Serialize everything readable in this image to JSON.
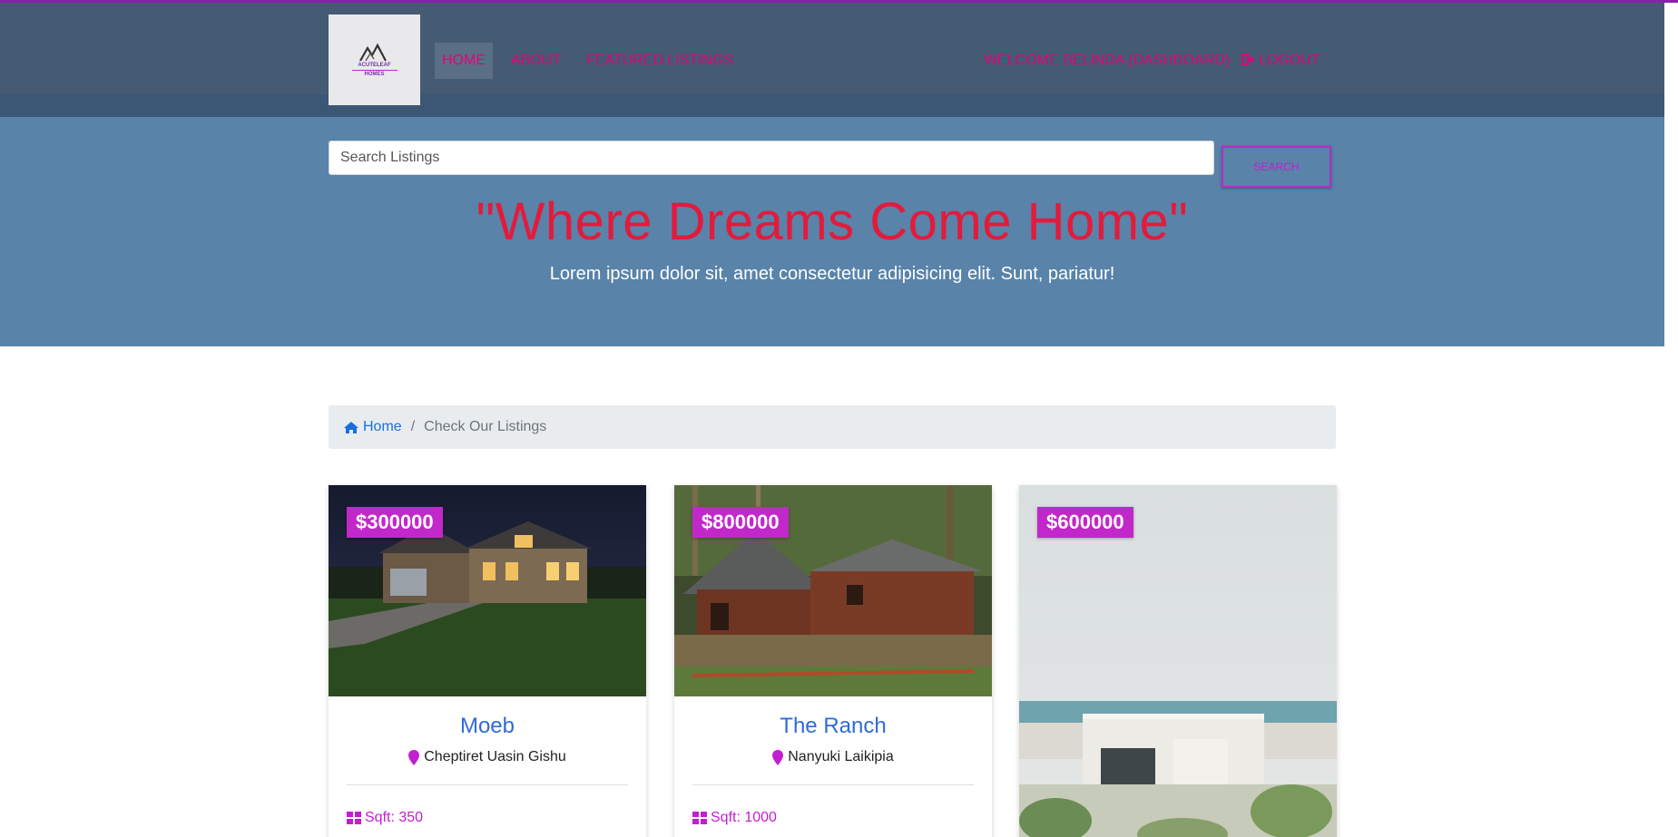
{
  "brand": {
    "logo_text_line1": "ACUTELEAF",
    "logo_text_line2": "HOMES"
  },
  "nav": {
    "home": "HOME",
    "about": "ABOUT",
    "featured": "FEATURED LISTINGS",
    "welcome": "WELCOME BELINDA (DASHBOARD)",
    "logout": "LOGOUT"
  },
  "search": {
    "placeholder": "Search Listings",
    "button_label": "SEARCH"
  },
  "hero": {
    "title": "\"Where Dreams Come Home\"",
    "subtitle": "Lorem ipsum dolor sit, amet consectetur adipisicing elit. Sunt, pariatur!"
  },
  "breadcrumb": {
    "home": "Home",
    "current": "Check Our Listings"
  },
  "listings": [
    {
      "price": "$300000",
      "title": "Moeb",
      "location": "Cheptiret Uasin Gishu",
      "sqft": "Sqft: 350"
    },
    {
      "price": "$800000",
      "title": "The Ranch",
      "location": "Nanyuki Laikipia",
      "sqft": "Sqft: 1000"
    },
    {
      "price": "$600000"
    }
  ],
  "colors": {
    "navbar": "#445b73",
    "hero": "#5983a9",
    "accent_pink": "#e6007a",
    "badge": "#c228c9",
    "hero_title": "#e21b3c",
    "link_blue": "#2f6bd8"
  },
  "icons": [
    "logout-icon",
    "home-icon",
    "map-marker-icon",
    "th-large-icon"
  ]
}
